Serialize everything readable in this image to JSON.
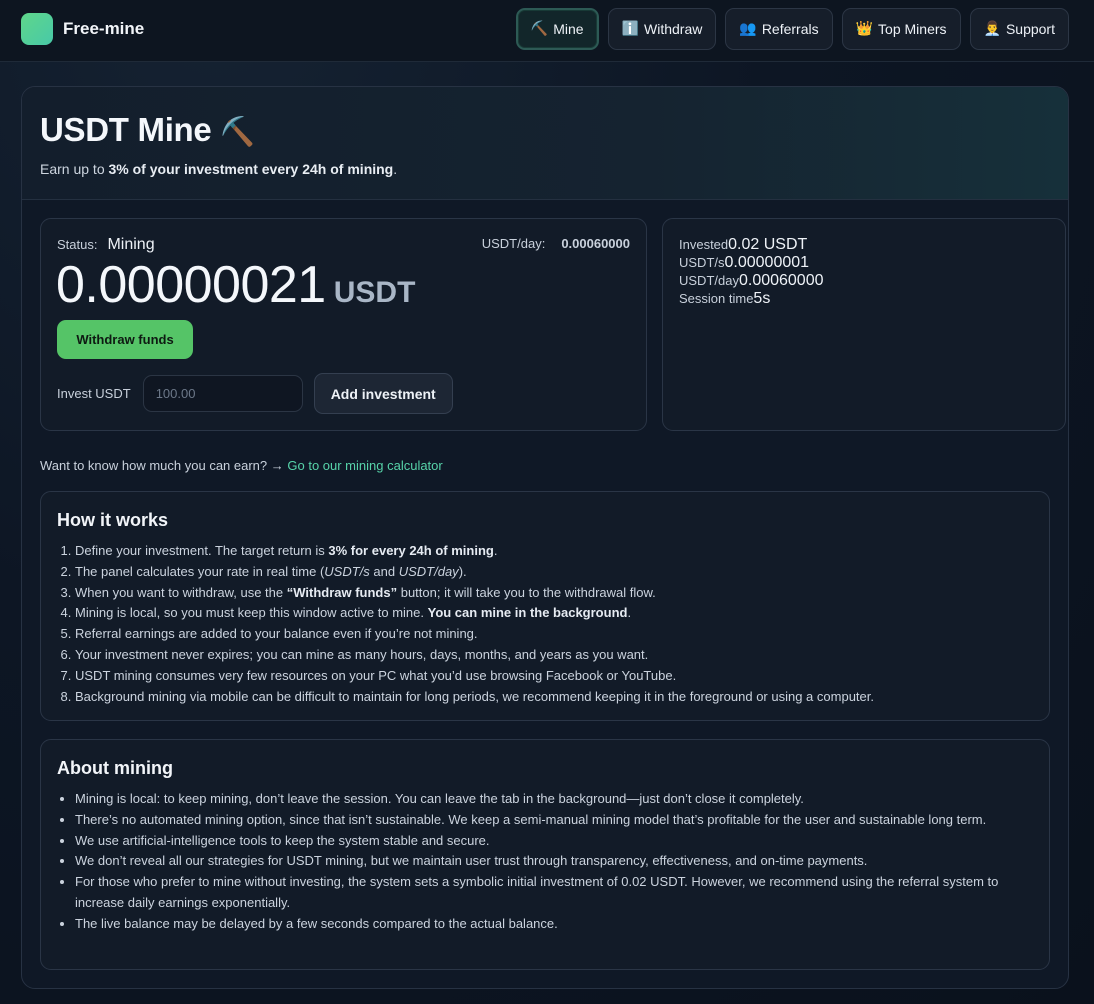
{
  "brand": {
    "name": "Free-mine"
  },
  "nav": [
    {
      "icon": "⛏️",
      "label": "Mine",
      "active": true
    },
    {
      "icon": "ℹ️",
      "label": "Withdraw"
    },
    {
      "icon": "👥",
      "label": "Referrals"
    },
    {
      "icon": "👑",
      "label": "Top Miners"
    },
    {
      "icon": "👨‍💼",
      "label": "Support"
    }
  ],
  "hero": {
    "title": "USDT Mine",
    "title_icon": "⛏️",
    "subtitle_prefix": "Earn up to ",
    "subtitle_bold": "3% of your investment every 24h of mining",
    "subtitle_suffix": "."
  },
  "status": {
    "label": "Status:",
    "value": "Mining",
    "rate_label": "USDT/day:",
    "rate_value": "0.00060000",
    "balance": "0.00000021",
    "unit": "USDT",
    "withdraw_label": "Withdraw funds",
    "invest_label": "Invest USDT",
    "invest_placeholder": "100.00",
    "add_label": "Add investment"
  },
  "stats": {
    "invested_label": "Invested",
    "invested_value": "0.02 USDT",
    "per_sec_label": "USDT/s",
    "per_sec_value": "0.00000001",
    "per_day_label": "USDT/day",
    "per_day_value": "0.00060000",
    "session_label": "Session time",
    "session_value": "5s"
  },
  "calculator": {
    "text": "Want to know how much you can earn? → ",
    "link": "Go to our mining calculator"
  },
  "how": {
    "title": "How it works",
    "items": [
      [
        "Define your investment. The target return is ",
        "3% for every 24h of mining",
        "."
      ],
      [
        "The panel calculates your rate in real time (",
        "USDT/s",
        " and ",
        "USDT/day",
        ")."
      ],
      [
        "When you want to withdraw, use the ",
        "“Withdraw funds”",
        " button; it will take you to the withdrawal flow."
      ],
      [
        "Mining is local, so you must keep this window active to mine. ",
        "You can mine in the background",
        "."
      ],
      "Referral earnings are added to your balance even if you’re not mining.",
      "Your investment never expires; you can mine as many hours, days, months, and years as you want.",
      "USDT mining consumes very few resources on your PC what you’d use browsing Facebook or YouTube.",
      "Background mining via mobile can be difficult to maintain for long periods, we recommend keeping it in the foreground or using a computer."
    ]
  },
  "about": {
    "title": "About mining",
    "items": [
      "Mining is local: to keep mining, don’t leave the session. You can leave the tab in the background—just don’t close it completely.",
      "There’s no automated mining option, since that isn’t sustainable. We keep a semi-manual mining model that’s profitable for the user and sustainable long term.",
      "We use artificial-intelligence tools to keep the system stable and secure.",
      "We don’t reveal all our strategies for USDT mining, but we maintain user trust through transparency, effectiveness, and on-time payments.",
      "For those who prefer to mine without investing, the system sets a symbolic initial investment of 0.02 USDT. However, we recommend using the referral system to increase daily earnings exponentially.",
      "The live balance may be delayed by a few seconds compared to the actual balance."
    ]
  },
  "colors": {
    "accent_green": "#55c467",
    "link_teal": "#57d3a9",
    "background": "#0b1220"
  }
}
